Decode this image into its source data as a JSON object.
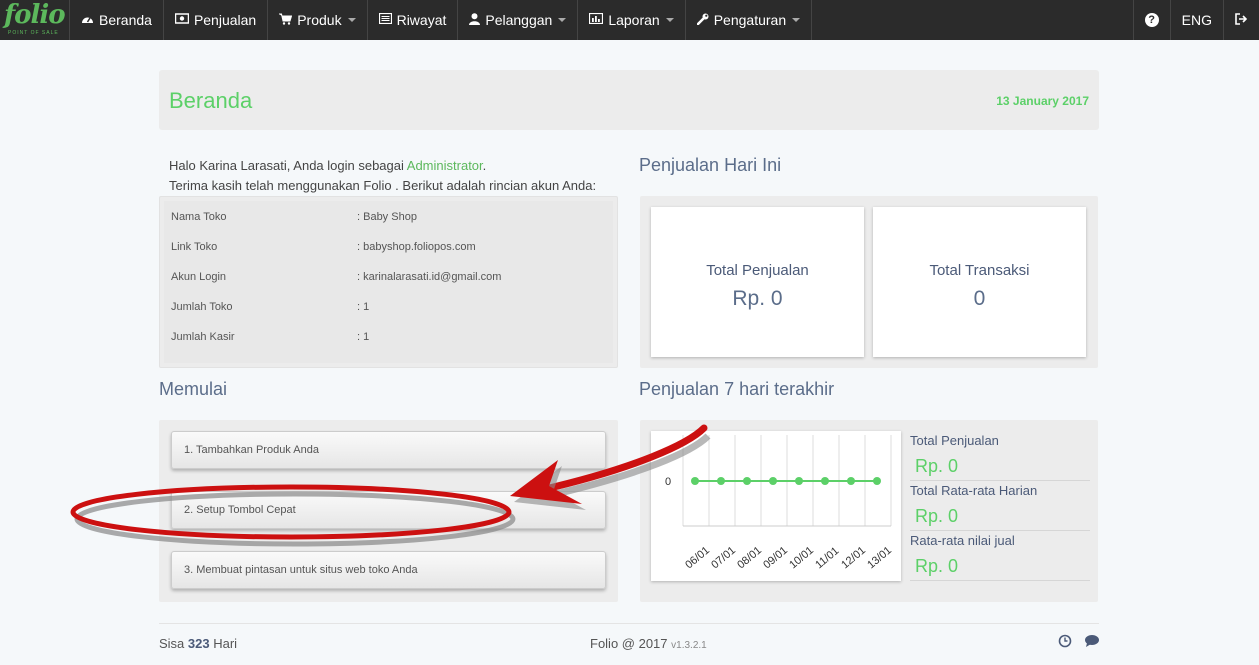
{
  "nav": {
    "logo_text": "folio",
    "logo_tagline": "POINT OF SALE",
    "items": [
      {
        "label": "Beranda",
        "icon": "dashboard-icon",
        "dropdown": false
      },
      {
        "label": "Penjualan",
        "icon": "money-icon",
        "dropdown": false
      },
      {
        "label": "Produk",
        "icon": "cart-icon",
        "dropdown": true
      },
      {
        "label": "Riwayat",
        "icon": "list-icon",
        "dropdown": false
      },
      {
        "label": "Pelanggan",
        "icon": "user-icon",
        "dropdown": true
      },
      {
        "label": "Laporan",
        "icon": "bar-chart-icon",
        "dropdown": true
      },
      {
        "label": "Pengaturan",
        "icon": "wrench-icon",
        "dropdown": true
      }
    ],
    "help_glyph": "?",
    "language": "ENG"
  },
  "header": {
    "title": "Beranda",
    "date": "13 January 2017"
  },
  "greeting": {
    "line1_prefix": "Halo Karina Larasati, Anda login sebagai ",
    "role": "Administrator",
    "line1_suffix": ".",
    "line2": "Terima kasih telah menggunakan Folio . Berikut adalah rincian akun Anda:"
  },
  "account": [
    {
      "label": "Nama Toko",
      "value": ": Baby Shop"
    },
    {
      "label": "Link Toko",
      "value": ": babyshop.foliopos.com"
    },
    {
      "label": "Akun Login",
      "value": ": karinalarasati.id@gmail.com"
    },
    {
      "label": "Jumlah Toko",
      "value": ": 1"
    },
    {
      "label": "Jumlah Kasir",
      "value": ": 1"
    }
  ],
  "sales_today": {
    "title": "Penjualan Hari Ini",
    "total_sales_label": "Total Penjualan",
    "total_sales_value": "Rp. 0",
    "total_tx_label": "Total Transaksi",
    "total_tx_value": "0"
  },
  "getting_started": {
    "title": "Memulai",
    "steps": [
      "1. Tambahkan Produk Anda",
      "2. Setup Tombol Cepat",
      "3. Membuat pintasan untuk situs web toko Anda"
    ]
  },
  "last7": {
    "title": "Penjualan 7 hari terakhir",
    "summary": [
      {
        "label": "Total Penjualan",
        "value": "Rp. 0"
      },
      {
        "label": "Total Rata-rata Harian",
        "value": "Rp. 0"
      },
      {
        "label": "Rata-rata nilai jual",
        "value": "Rp. 0"
      }
    ]
  },
  "chart_data": {
    "type": "line",
    "categories": [
      "06/01",
      "07/01",
      "08/01",
      "09/01",
      "10/01",
      "11/01",
      "12/01",
      "13/01"
    ],
    "values": [
      0,
      0,
      0,
      0,
      0,
      0,
      0,
      0
    ],
    "y_tick_labels": [
      "0"
    ],
    "title": "",
    "xlabel": "",
    "ylabel": "",
    "grid": true,
    "line_color": "#5cd068"
  },
  "footer": {
    "remaining_prefix": "Sisa ",
    "remaining_days": "323",
    "remaining_suffix": " Hari",
    "copyright": "Folio @ 2017",
    "version": "v1.3.2.1"
  },
  "colors": {
    "accent_green": "#5cd068",
    "navbar_bg": "#2b2b2b",
    "annotation_red": "#cc1010"
  }
}
